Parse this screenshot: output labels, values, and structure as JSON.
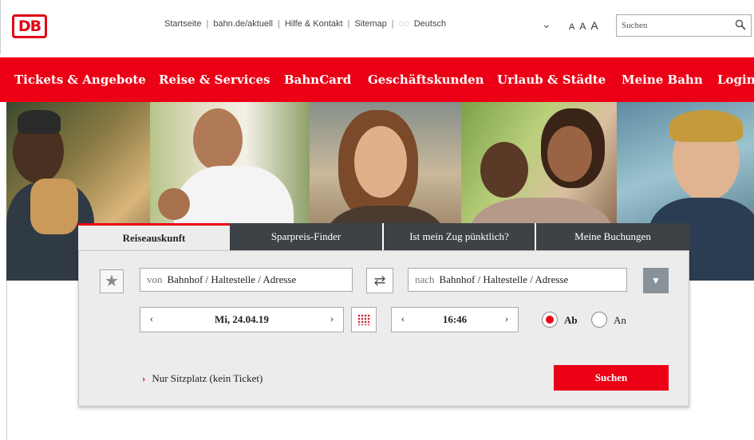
{
  "header": {
    "logo_text": "DB",
    "util_links": [
      "Startseite",
      "bahn.de/aktuell",
      "Hilfe & Kontakt",
      "Sitemap"
    ],
    "language": "Deutsch",
    "font_sizes": [
      "A",
      "A",
      "A"
    ],
    "search_placeholder": "Suchen"
  },
  "nav": {
    "items": [
      "Tickets & Angebote",
      "Reise & Services",
      "BahnCard",
      "Geschäftskunden",
      "Urlaub & Städte",
      "Meine Bahn",
      "Login"
    ]
  },
  "booking": {
    "tabs": [
      "Reiseauskunft",
      "Sparpreis-Finder",
      "Ist mein Zug pünktlich?",
      "Meine Buchungen"
    ],
    "active_tab": 0,
    "from_prefix": "von",
    "from_value": "Bahnhof / Haltestelle / Adresse",
    "to_prefix": "nach",
    "to_value": "Bahnhof / Haltestelle / Adresse",
    "date": "Mi, 24.04.19",
    "time": "16:46",
    "radio_ab": "Ab",
    "radio_an": "An",
    "seat_link": "Nur Sitzplatz (kein Ticket)",
    "search_button": "Suchen"
  },
  "colors": {
    "brand_red": "#ec0016",
    "tab_dark": "#3d4247"
  }
}
